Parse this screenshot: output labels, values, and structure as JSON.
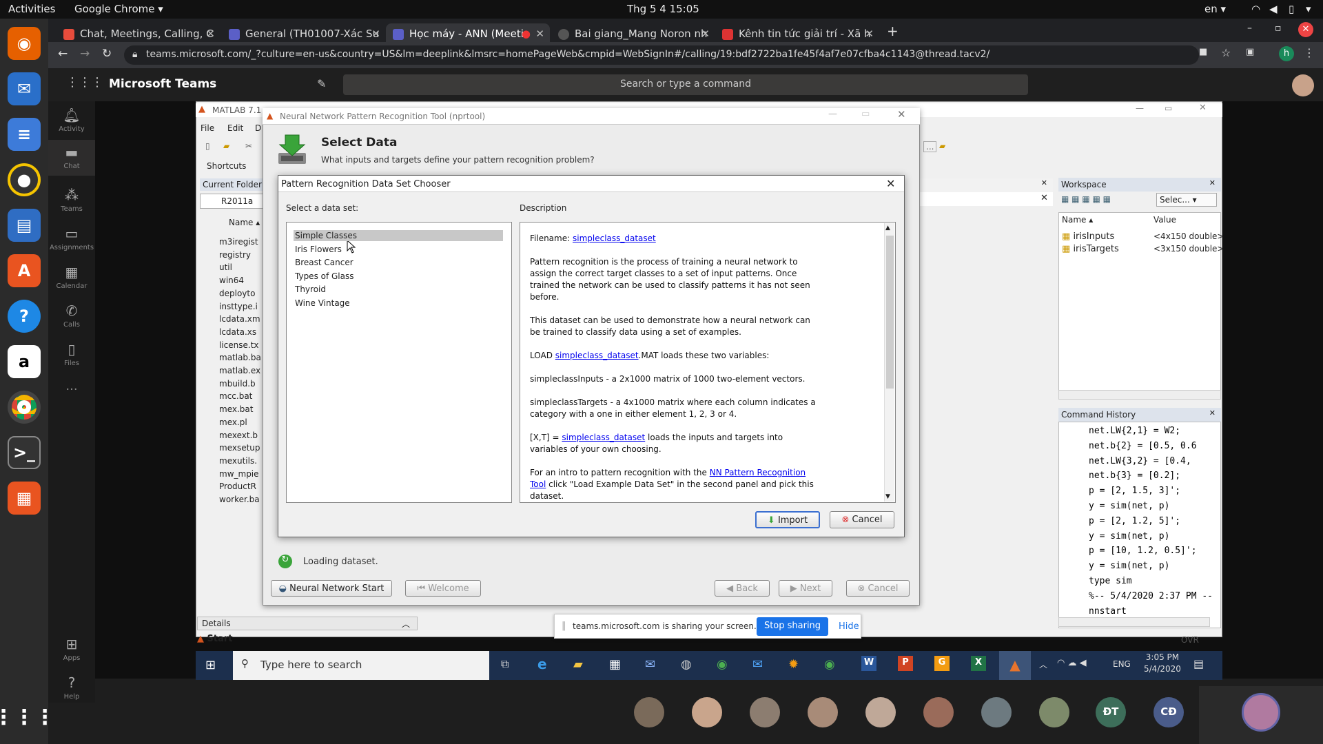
{
  "gnome": {
    "activities": "Activities",
    "app": "Google Chrome ▾",
    "clock": "Thg 5 4  15:05",
    "lang": "en ▾"
  },
  "chrome": {
    "tabs": [
      {
        "label": "Chat, Meetings, Calling, C",
        "color": "#e74c3c"
      },
      {
        "label": "General (TH01007-Xác Su",
        "color": "#5b5fc7"
      },
      {
        "label": "Học máy - ANN (Meeti",
        "color": "#5b5fc7"
      },
      {
        "label": "Bai giang_Mang Noron nh",
        "color": "#555"
      },
      {
        "label": "Kênh tin tức giải trí - Xã h",
        "color": "#d33"
      }
    ],
    "url": "teams.microsoft.com/_?culture=en-us&country=US&lm=deeplink&lmsrc=homePageWeb&cmpid=WebSignIn#/calling/19:bdf2722ba1fe45f4af7e07cfba4c1143@thread.tacv2/"
  },
  "teams": {
    "title": "Microsoft Teams",
    "search": "Search or type a command",
    "rail": [
      "Activity",
      "Chat",
      "Teams",
      "Assignments",
      "Calendar",
      "Calls",
      "Files",
      "Apps",
      "Help"
    ],
    "share_bar": {
      "text": "teams.microsoft.com is sharing your screen.",
      "stop": "Stop sharing",
      "hide": "Hide"
    },
    "avatars": [
      "ĐT",
      "CĐ"
    ]
  },
  "matlab": {
    "title": "MATLAB 7.1",
    "menu": [
      "File",
      "Edit",
      "D"
    ],
    "shortcuts": "Shortcuts",
    "current_folder": "Current Folder",
    "folder": "R2011a",
    "name_col": "Name ▴",
    "files": [
      "m3iregist",
      "registry",
      "util",
      "win64",
      "deployto",
      "insttype.i",
      "lcdata.xm",
      "lcdata.xs",
      "license.tx",
      "matlab.ba",
      "matlab.ex",
      "mbuild.b",
      "mcc.bat",
      "mex.bat",
      "mex.pl",
      "mexext.b",
      "mexsetup",
      "mexutils.",
      "mw_mpie",
      "ProductR",
      "worker.ba"
    ],
    "details": "Details",
    "start": "Start",
    "ovr": "OVR",
    "workspace": {
      "title": "Workspace",
      "select": "Selec...",
      "col_name": "Name ▴",
      "col_value": "Value",
      "rows": [
        {
          "name": "irisInputs",
          "value": "<4x150 double>"
        },
        {
          "name": "irisTargets",
          "value": "<3x150 double>"
        }
      ]
    },
    "history": {
      "title": "Command History",
      "lines": [
        "net.LW{2,1} = W2;",
        "net.b{2} = [0.5, 0.6",
        "net.LW{3,2} = [0.4,",
        "net.b{3} = [0.2];",
        "p = [2, 1.5, 3]';",
        "y = sim(net, p)",
        "p = [2, 1.2, 5]';",
        "y = sim(net, p)",
        "p = [10, 1.2, 0.5]';",
        "y = sim(net, p)",
        "type sim",
        "%-- 5/4/2020 2:37 PM --",
        "nnstart"
      ]
    }
  },
  "nprtool": {
    "title": "Neural Network Pattern Recognition Tool (nprtool)",
    "heading": "Select Data",
    "subheading": "What inputs and targets define your pattern recognition problem?",
    "status": "Loading dataset.",
    "buttons": {
      "nn_start": "Neural Network Start",
      "welcome": "Welcome",
      "back": "Back",
      "next": "Next",
      "cancel": "Cancel"
    }
  },
  "chooser": {
    "title": "Pattern Recognition Data Set Chooser",
    "select_label": "Select a data set:",
    "desc_label": "Description",
    "datasets": [
      "Simple Classes",
      "Iris Flowers",
      "Breast Cancer",
      "Types of Glass",
      "Thyroid",
      "Wine Vintage"
    ],
    "selected": 0,
    "desc": {
      "filename_label": "Filename:",
      "filename": "simpleclass_dataset",
      "p1": "Pattern recognition is the process of training a neural network to assign the correct target classes to a set of input patterns. Once trained the network can be used to classify patterns it has not seen before.",
      "p2": "This dataset can be used to demonstrate how a neural network can be trained to classify data using a set of examples.",
      "p3_pre": "LOAD ",
      "p3_link": "simpleclass_dataset",
      "p3_post": ".MAT loads these two variables:",
      "p4": "simpleclassInputs - a 2x1000 matrix of 1000 two-element vectors.",
      "p5": "simpleclassTargets - a 4x1000 matrix where each column indicates a category with a one in either element 1, 2, 3 or 4.",
      "p6_pre": "[X,T] = ",
      "p6_link": "simpleclass_dataset",
      "p6_post": " loads the inputs and targets into variables of your own choosing.",
      "p7_pre": "For an intro to pattern recognition with the ",
      "p7_link": "NN Pattern Recognition Tool",
      "p7_post": " click \"Load Example Data Set\" in the second panel and pick this dataset."
    },
    "import": "Import",
    "cancel": "Cancel"
  },
  "win": {
    "search": "Type here to search",
    "lang": "ENG",
    "time": "3:05 PM",
    "date": "5/4/2020"
  }
}
